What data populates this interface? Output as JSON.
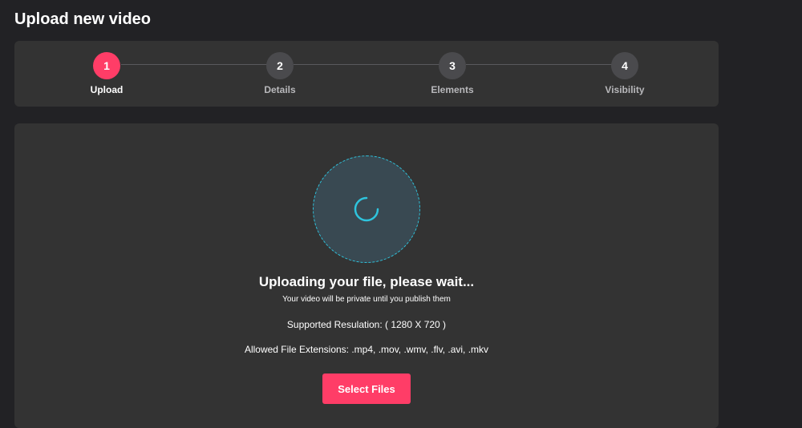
{
  "page": {
    "title": "Upload new video"
  },
  "stepper": {
    "steps": [
      {
        "number": "1",
        "label": "Upload",
        "active": true
      },
      {
        "number": "2",
        "label": "Details",
        "active": false
      },
      {
        "number": "3",
        "label": "Elements",
        "active": false
      },
      {
        "number": "4",
        "label": "Visibility",
        "active": false
      }
    ]
  },
  "upload": {
    "status_title": "Uploading your file, please wait...",
    "status_subtitle": "Your video will be private until you publish them",
    "resolution": "Supported Resulation: ( 1280 X 720 )",
    "extensions": "Allowed File Extensions: .mp4, .mov, .wmv, .flv, .avi, .mkv",
    "select_button": "Select Files",
    "spinner_icon": "loading-spinner-icon"
  },
  "colors": {
    "background": "#222225",
    "card": "#333333",
    "accent": "#ff3d67",
    "spinner": "#2ec4dd",
    "inactive_step": "#4a4a4d"
  }
}
